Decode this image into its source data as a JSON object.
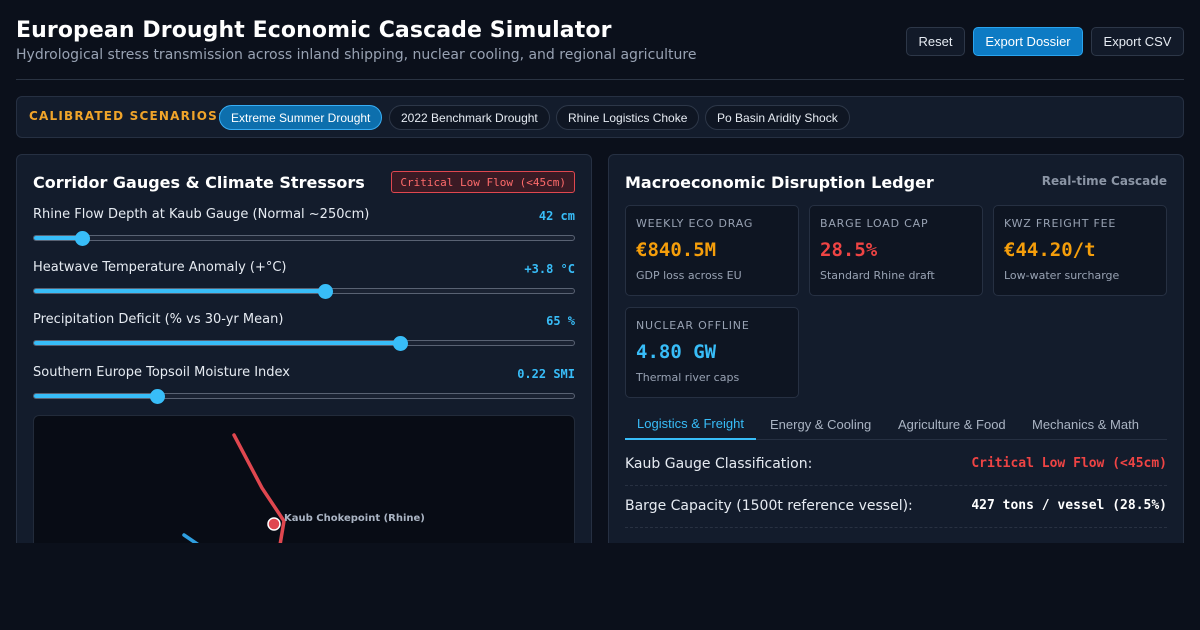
{
  "header": {
    "title": "European Drought Economic Cascade Simulator",
    "subtitle": "Hydrological stress transmission across inland shipping, nuclear cooling, and regional agriculture",
    "buttons": {
      "reset": "Reset",
      "export_dossier": "Export Dossier",
      "export_csv": "Export CSV"
    }
  },
  "scenarios": {
    "label": "CALIBRATED SCENARIOS:",
    "items": [
      {
        "label": "Extreme Summer Drought",
        "active": true
      },
      {
        "label": "2022 Benchmark Drought",
        "active": false
      },
      {
        "label": "Rhine Logistics Choke",
        "active": false
      },
      {
        "label": "Po Basin Aridity Shock",
        "active": false
      }
    ]
  },
  "left_panel": {
    "title": "Corridor Gauges & Climate Stressors",
    "status_badge": "Critical Low Flow (<45cm)",
    "sliders": [
      {
        "label": "Rhine Flow Depth at Kaub Gauge (Normal ~250cm)",
        "value_text": "42 cm",
        "fraction": 0.09
      },
      {
        "label": "Heatwave Temperature Anomaly (+°C)",
        "value_text": "+3.8 °C",
        "fraction": 0.54
      },
      {
        "label": "Precipitation Deficit (% vs 30-yr Mean)",
        "value_text": "65 %",
        "fraction": 0.68
      },
      {
        "label": "Southern Europe Topsoil Moisture Index",
        "value_text": "0.22 SMI",
        "fraction": 0.23
      }
    ],
    "map": {
      "chokepoint_label": "Kaub Chokepoint (Rhine)"
    }
  },
  "right_panel": {
    "title": "Macroeconomic Disruption Ledger",
    "realtime_label": "Real-time Cascade",
    "kpis": [
      {
        "label": "WEEKLY ECO DRAG",
        "value": "€840.5M",
        "sub": "GDP loss across EU",
        "color": "#f59e0b"
      },
      {
        "label": "BARGE LOAD CAP",
        "value": "28.5%",
        "sub": "Standard Rhine draft",
        "color": "#ef4444"
      },
      {
        "label": "KWZ FREIGHT FEE",
        "value": "€44.20/t",
        "sub": "Low-water surcharge",
        "color": "#f59e0b"
      },
      {
        "label": "NUCLEAR OFFLINE",
        "value": "4.80 GW",
        "sub": "Thermal river caps",
        "color": "#38bdf8"
      }
    ],
    "tabs": [
      {
        "label": "Logistics & Freight",
        "active": true
      },
      {
        "label": "Energy & Cooling",
        "active": false
      },
      {
        "label": "Agriculture & Food",
        "active": false
      },
      {
        "label": "Mechanics & Math",
        "active": false
      }
    ],
    "ledger": [
      {
        "key": "Kaub Gauge Classification:",
        "value": "Critical Low Flow (<45cm)",
        "color": "#ef4444"
      },
      {
        "key": "Barge Capacity (1500t reference vessel):",
        "value": "427 tons / vessel (28.5%)",
        "color": "#ffffff"
      }
    ]
  },
  "colors": {
    "accent": "#38bdf8",
    "primary_button": "#0d7bc4",
    "warning": "#f0a42a",
    "critical": "#ef4444",
    "river_red": "#e0474f",
    "river_blue": "#38bdf8"
  }
}
